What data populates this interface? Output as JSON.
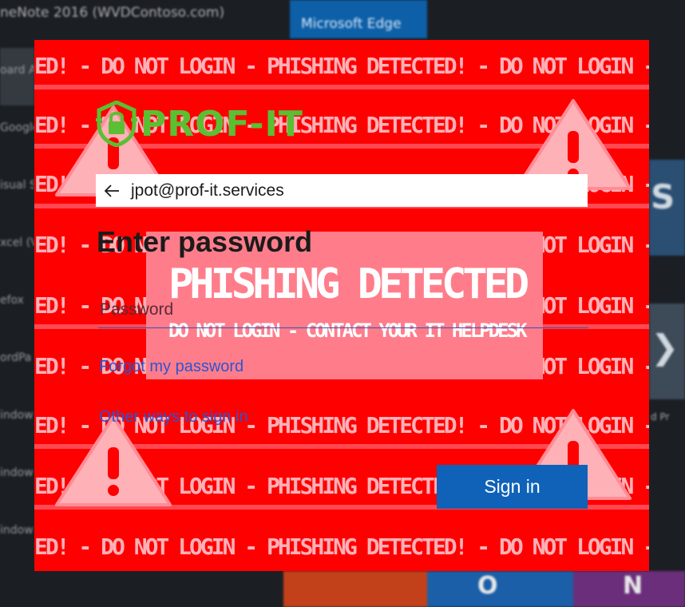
{
  "background": {
    "top_title": "neNote 2016 (WVDContoso.com)",
    "edge_tile_label": "Microsoft Edge",
    "left_items": [
      "oard A",
      "Google",
      "isual S",
      "xcel (V",
      "efox",
      "ordPa",
      "indow",
      "indow",
      "indow"
    ],
    "right_label": "d Pr",
    "bottom_glyphs": [
      "O",
      "N"
    ]
  },
  "warning": {
    "rows": [
      "ED! - DO NOT LOGIN - PHISHING DETECTED! - DO NOT LOGIN - PHISHING DETECTED",
      "ED! - DO NOT LOGIN - PHISHING DETECTED! - DO NOT LOGIN - PHISHING DETECTED",
      "ED! - DO NOT LOGIN - PHISHING DETECTED! - DO NOT LOGIN - PHISHING DETECTED",
      "ED! - DO NOT LOGIN - PHISHING DETECTED! - DO NOT LOGIN - PHISHING DETECTED",
      "ED! - DO NOT LOGIN - PHISHING DETECTED! - DO NOT LOGIN - PHISHING DETECTED",
      "ED! - DO NOT LOGIN - PHISHING DETECTED! - DO NOT LOGIN - PHISHING DETECTED",
      "ED! - DO NOT LOGIN - PHISHING DETECTED! - DO NOT LOGIN - PHISHING DETECTED",
      "ED! - DO NOT LOGIN - PHISHING DETECTED! - DO NOT LOGIN - PHISHING DETECTED",
      "ED! - DO NOT LOGIN - PHISHING DETECTED! - DO NOT LOGIN - PHISHING DETECTED"
    ],
    "card_title": "PHISHING DETECTED",
    "card_subtitle": "DO NOT LOGIN - CONTACT YOUR IT HELPDESK"
  },
  "login": {
    "logo_text": "PROF-IT",
    "email": "jpot@prof-it.services",
    "heading": "Enter password",
    "password_placeholder": "Password",
    "forgot_link": "Forgot my password",
    "other_ways_link": "Other ways to sign in",
    "signin_button": "Sign in"
  },
  "colors": {
    "dialog_bg": "#ff0000",
    "warning_text": "#ffb1b8",
    "logo_green": "#5bbf33",
    "button_blue": "#0f62b8",
    "link_blue": "#2d54d0"
  }
}
